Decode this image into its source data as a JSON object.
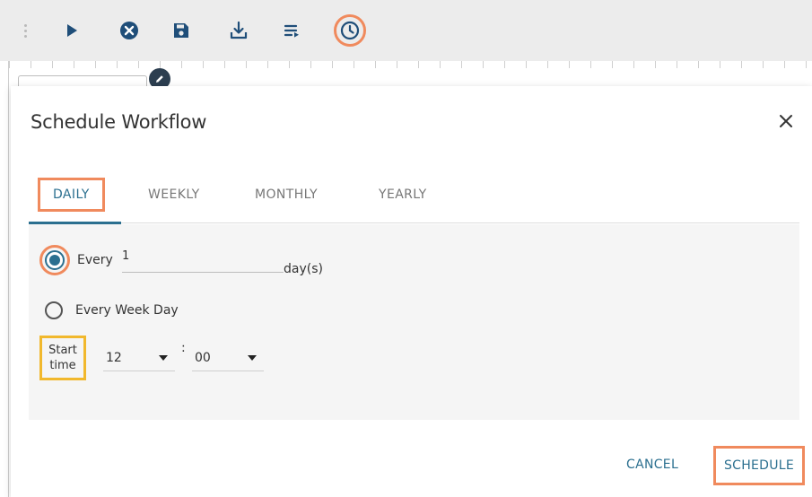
{
  "toolbar": {
    "icons": [
      "drag-handle-icon",
      "play-icon",
      "cancel-circle-icon",
      "save-icon",
      "download-icon",
      "list-icon",
      "clock-icon"
    ]
  },
  "dialog": {
    "title": "Schedule Workflow",
    "close_icon": "close-icon",
    "tabs": [
      {
        "label": "DAILY",
        "active": true
      },
      {
        "label": "WEEKLY",
        "active": false
      },
      {
        "label": "MONTHLY",
        "active": false
      },
      {
        "label": "YEARLY",
        "active": false
      }
    ],
    "daily": {
      "option_every": {
        "label": "Every",
        "selected": true,
        "value": "1",
        "suffix": "day(s)"
      },
      "option_weekday": {
        "label": "Every Week Day",
        "selected": false
      },
      "start_time": {
        "label_line1": "Start",
        "label_line2": "time",
        "hour": "12",
        "separator": ":",
        "minute": "00"
      }
    },
    "actions": {
      "cancel": "CANCEL",
      "schedule": "SCHEDULE"
    }
  },
  "colors": {
    "accent": "#2b6f8f",
    "highlight_orange": "#f08a5d",
    "highlight_yellow": "#f1b82d",
    "toolbar_icon": "#1f4e79"
  }
}
